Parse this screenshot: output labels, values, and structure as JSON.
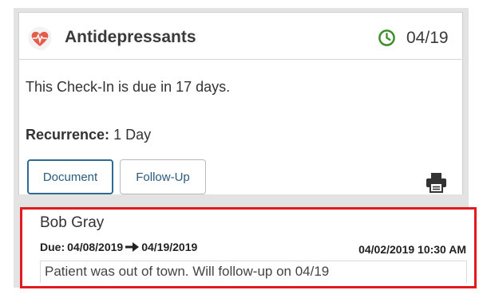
{
  "card": {
    "title": "Antidepressants",
    "title_icon": "heart-pulse-icon",
    "date": "04/19",
    "date_icon": "clock-icon",
    "due_text": "This Check-In is due in 17 days.",
    "recurrence_label": "Recurrence:",
    "recurrence_value": "1 Day",
    "print_icon": "printer-icon"
  },
  "buttons": {
    "document": "Document",
    "follow_up": "Follow-Up"
  },
  "entry": {
    "name": "Bob Gray",
    "due_label": "Due:",
    "due_from": "04/08/2019",
    "due_to": "04/19/2019",
    "arrow_icon": "arrow-right-icon",
    "timestamp": "04/02/2019 10:30 AM",
    "note": "Patient was out of town. Will follow-up on 04/19"
  },
  "colors": {
    "heart": "#e35d4a",
    "clock": "#3f8c2b",
    "button_text": "#2a5a7d",
    "highlight_border": "#e21b22"
  }
}
